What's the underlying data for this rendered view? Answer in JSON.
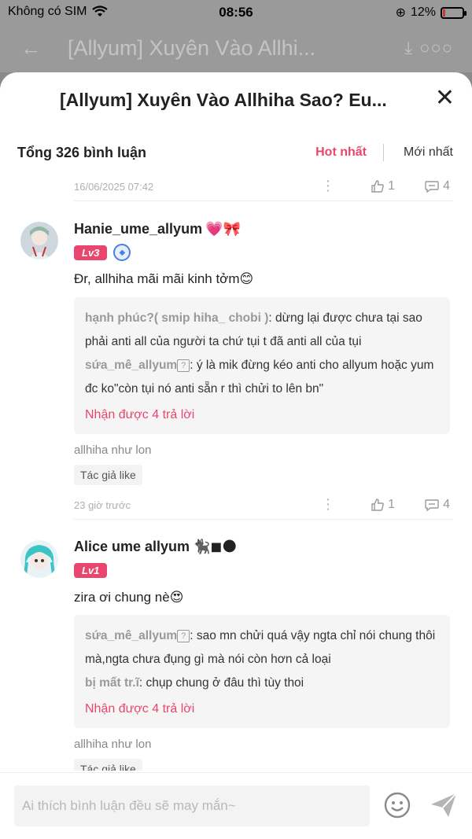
{
  "status_bar": {
    "carrier": "Không có SIM",
    "time": "08:56",
    "battery": "12%",
    "battery_level": 0.12
  },
  "background_header": {
    "title": "[Allyum] Xuyên Vào Allhi..."
  },
  "sheet": {
    "title": "[Allyum] Xuyên Vào Allhiha Sao? Eu...",
    "total_comments": "Tổng 326 bình luận",
    "sort_hot": "Hot nhất",
    "sort_new": "Mới nhất"
  },
  "first_meta": {
    "date": "16/06/2025 07:42",
    "likes": "1",
    "replies": "4"
  },
  "comments": [
    {
      "username": "Hanie_ume_allyum",
      "emojis": "💗🎀",
      "level": "Lv3",
      "text": "Đr, allhiha mãi mãi kinh tởm😊",
      "replies": [
        {
          "user": "hạnh phúc?( smip hiha_ chobi )",
          "text": ": dừng lại được chưa tại sao phải anti all của người ta chứ tụi t đã anti all của tụi"
        },
        {
          "user": "sứa_mê_allyum",
          "text": ": ý là mik đừng kéo anti cho allyum hoặc yum đc ko\"còn tụi nó anti sẵn r thì chửi to lên bn\""
        }
      ],
      "more_replies": "Nhận được 4 trả lời",
      "book": "allhiha như lon",
      "author_like": "Tác giả like",
      "time": "23 giờ trước",
      "likes": "1",
      "reply_count": "4"
    },
    {
      "username": "Alice ume allyum",
      "emojis": "🐈‍⬛◼︎🌑",
      "level": "Lv1",
      "text": "zira ơi chung nè😍",
      "replies": [
        {
          "user": "sứa_mê_allyum",
          "text": ": sao mn chửi quá vậy ngta chỉ nói chung thôi mà,ngta chưa đụng gì mà nói còn hơn cả loại"
        },
        {
          "user": "bị mất tr.ĩ",
          "text": ": chụp chung ở đâu thì tùy thoi"
        }
      ],
      "more_replies": "Nhận được 4 trả lời",
      "book": "allhiha như lon",
      "author_like": "Tác giả like"
    }
  ],
  "bottom_bar": {
    "placeholder": "Ai thích bình luận đều sẽ may mắn~"
  },
  "colors": {
    "accent": "#e8466c",
    "level_badge": "#e8466c",
    "reply_bg": "#f5f5f5"
  },
  "icons": [
    "wifi-icon",
    "battery-icon",
    "back-arrow-icon",
    "download-icon",
    "more-icon",
    "close-icon",
    "like-icon",
    "reply-icon",
    "emoji-icon",
    "send-icon"
  ]
}
